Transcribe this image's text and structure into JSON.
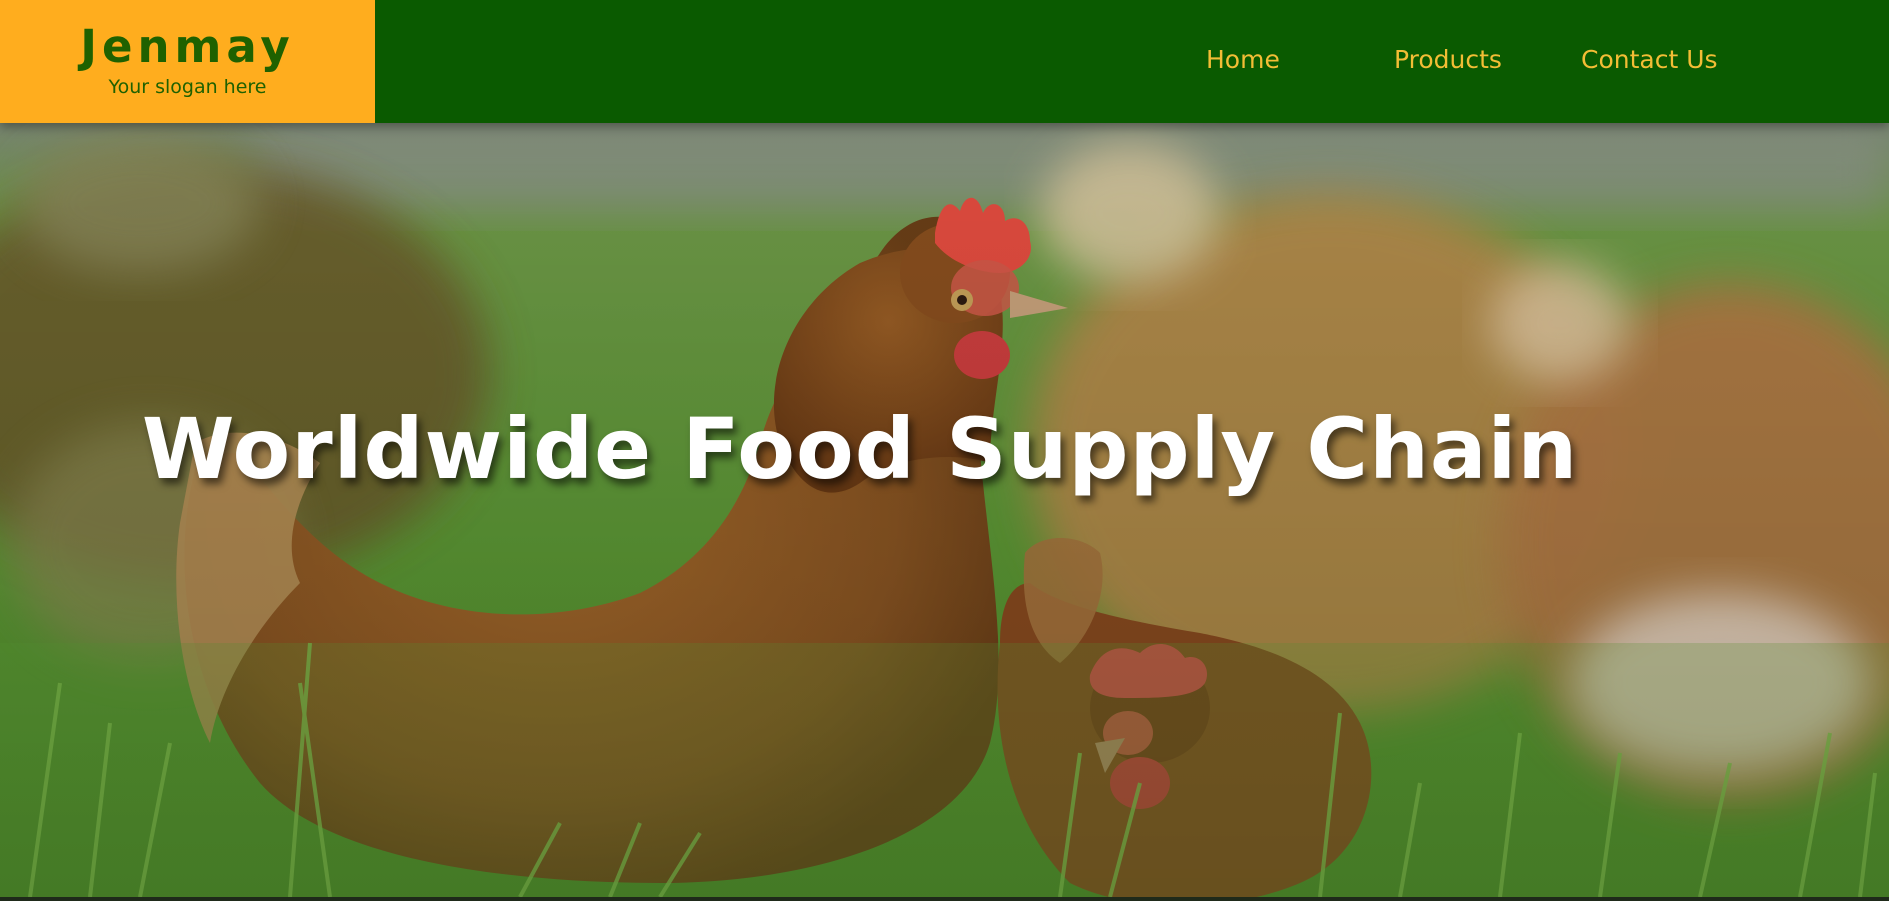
{
  "brand": {
    "name": "Jenmay",
    "slogan": "Your slogan here"
  },
  "nav": {
    "items": [
      "Home",
      "Products",
      "Contact Us"
    ]
  },
  "hero": {
    "title": "Worldwide Food Supply Chain",
    "background_image": "hens-in-grass-photo"
  },
  "colors": {
    "header_bg": "#0a5a00",
    "brand_bg": "#ffad1e",
    "brand_text": "#1f6100",
    "nav_text": "#f2bd35",
    "hero_title": "#ffffff"
  }
}
